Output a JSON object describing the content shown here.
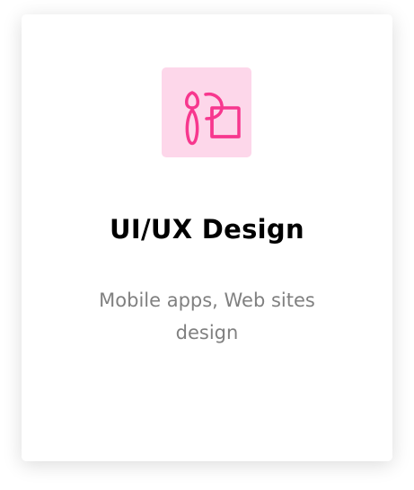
{
  "card": {
    "icon": "brush-and-frame-icon",
    "title": "UI/UX Design",
    "description": "Mobile apps, Web sites design",
    "accent_color": "#f7378e",
    "icon_bg_color": "#fdd7ea"
  }
}
